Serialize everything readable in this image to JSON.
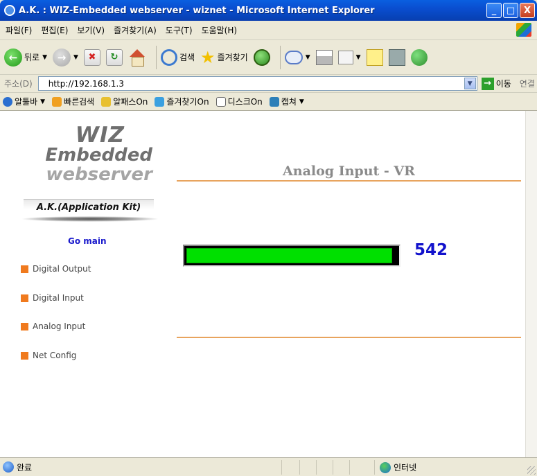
{
  "window": {
    "title": "A.K. : WIZ-Embedded webserver - wiznet - Microsoft Internet Explorer",
    "minimize": "_",
    "maximize": "□",
    "close": "X"
  },
  "menu": [
    "파일(F)",
    "편집(E)",
    "보기(V)",
    "즐겨찾기(A)",
    "도구(T)",
    "도움말(H)"
  ],
  "toolbar": {
    "back_label": "뒤로",
    "search_label": "검색",
    "favorites_label": "즐겨찾기"
  },
  "address": {
    "label": "주소(D)",
    "url": "http://192.168.1.3",
    "go_label": "이동",
    "links_label": "연결"
  },
  "links_bar": [
    "알툴바",
    "빠른검색",
    "알패스On",
    "즐겨찾기On",
    "디스크On",
    "캡쳐"
  ],
  "logo": {
    "line1": "WIZ",
    "line2": "Embedded",
    "line3": "webserver",
    "kit": "A.K.(Application Kit)"
  },
  "nav": {
    "go_main": "Go main",
    "items": [
      "Digital Output",
      "Digital Input",
      "Analog Input",
      "Net Config"
    ]
  },
  "page": {
    "title": "Analog Input - VR",
    "value": "542",
    "level_fraction": 0.985
  },
  "status": {
    "done": "완료",
    "zone": "인터넷"
  },
  "colors": {
    "bar_fill": "#00e000",
    "value_text": "#1212cc",
    "accent_orange": "#f07a1e",
    "divider": "#e8a45e"
  }
}
